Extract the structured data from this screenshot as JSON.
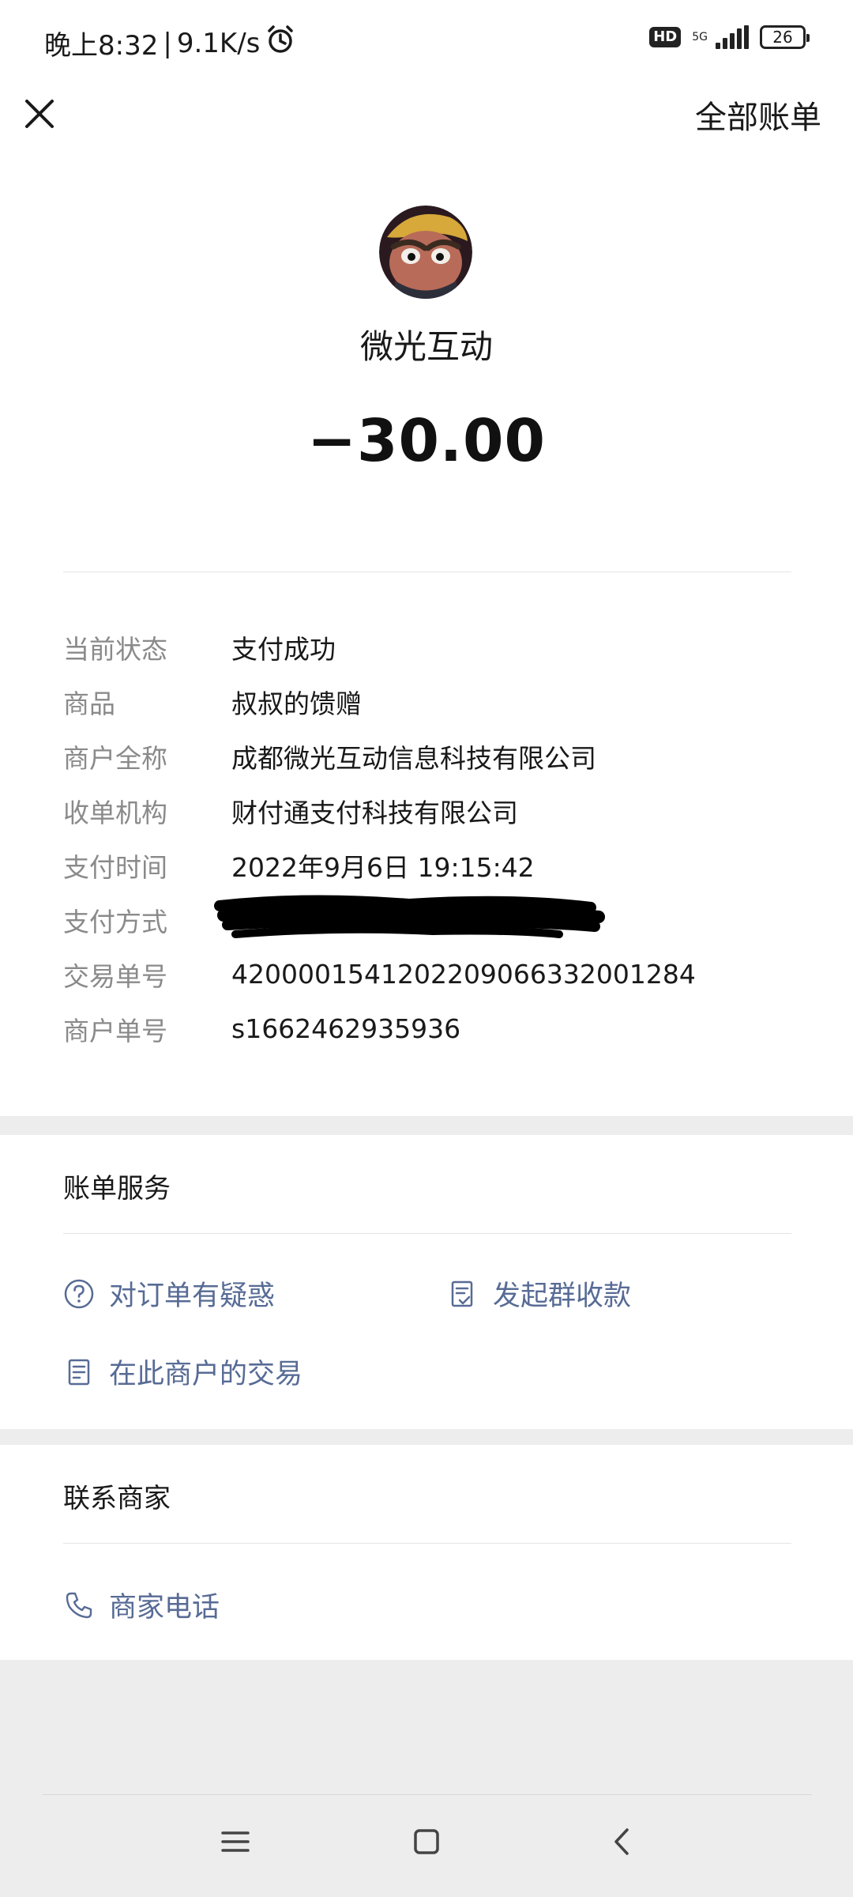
{
  "status_bar": {
    "time": "晚上8:32",
    "speed": "9.1K/s",
    "hd": "HD",
    "network": "5G",
    "battery": "26"
  },
  "navbar": {
    "right_label": "全部账单"
  },
  "header": {
    "merchant_name": "微光互动",
    "amount": "−30.00"
  },
  "details": [
    {
      "label": "当前状态",
      "value": "支付成功"
    },
    {
      "label": "商品",
      "value": "叔叔的馈赠"
    },
    {
      "label": "商户全称",
      "value": "成都微光互动信息科技有限公司"
    },
    {
      "label": "收单机构",
      "value": "财付通支付科技有限公司"
    },
    {
      "label": "支付时间",
      "value": "2022年9月6日 19:15:42"
    },
    {
      "label": "支付方式",
      "value": ""
    },
    {
      "label": "交易单号",
      "value": "4200001541202209066332001284"
    },
    {
      "label": "商户单号",
      "value": "s1662462935936"
    }
  ],
  "bill_service": {
    "title": "账单服务",
    "actions": [
      {
        "label": "对订单有疑惑",
        "icon": "question-circle-icon"
      },
      {
        "label": "发起群收款",
        "icon": "group-collect-icon"
      },
      {
        "label": "在此商户的交易",
        "icon": "receipt-icon"
      }
    ]
  },
  "contact": {
    "title": "联系商家",
    "actions": [
      {
        "label": "商家电话",
        "icon": "phone-icon"
      }
    ]
  },
  "colors": {
    "link": "#576b95",
    "label_gray": "#8a8a8a",
    "background": "#ededed"
  }
}
